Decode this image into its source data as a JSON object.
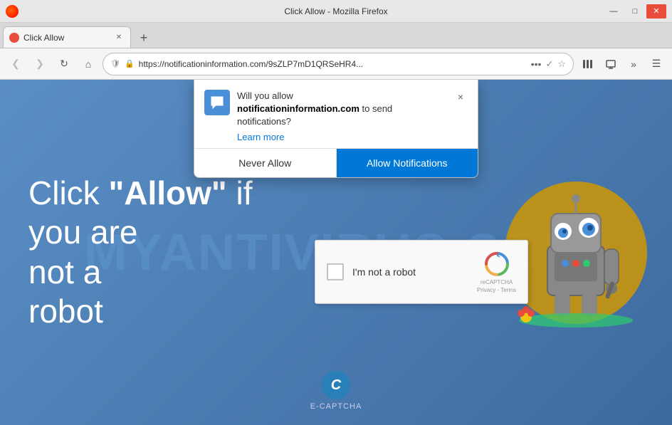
{
  "browser": {
    "title": "Click Allow - Mozilla Firefox",
    "tab_label": "Click Allow",
    "url": "https://notificationinformation.com/9sZLP7mD1QRSeHR4",
    "url_display": "https://notificationinformation.com/9sZLP7mD1QRSeHR4..."
  },
  "nav_buttons": {
    "back": "‹",
    "forward": "›",
    "refresh": "↻",
    "home": "⌂"
  },
  "toolbar": {
    "dots_label": "•••",
    "bookmark_label": "☆",
    "library_label": "📚",
    "synced_tabs_label": "⊟",
    "more_label": "»",
    "menu_label": "≡"
  },
  "notification": {
    "question": "Will you allow",
    "domain": "notificationinformation.com",
    "suffix": "to send notifications?",
    "learn_more": "Learn more",
    "close_label": "×",
    "never_allow_label": "Never Allow",
    "allow_label": "Allow Notifications"
  },
  "page": {
    "heading_part1": "Click ",
    "heading_bold": "\"Allow\"",
    "heading_part2": " if",
    "heading_line2": "you are",
    "heading_line3": "not a",
    "heading_line4": "robot",
    "watermark": "MYANTIVIRUS.COM"
  },
  "recaptcha": {
    "label": "I'm not a robot",
    "brand": "reCAPTCHA",
    "privacy": "Privacy",
    "terms": "Terms"
  },
  "ecaptcha": {
    "letter": "C",
    "label": "E-CAPTCHA"
  }
}
